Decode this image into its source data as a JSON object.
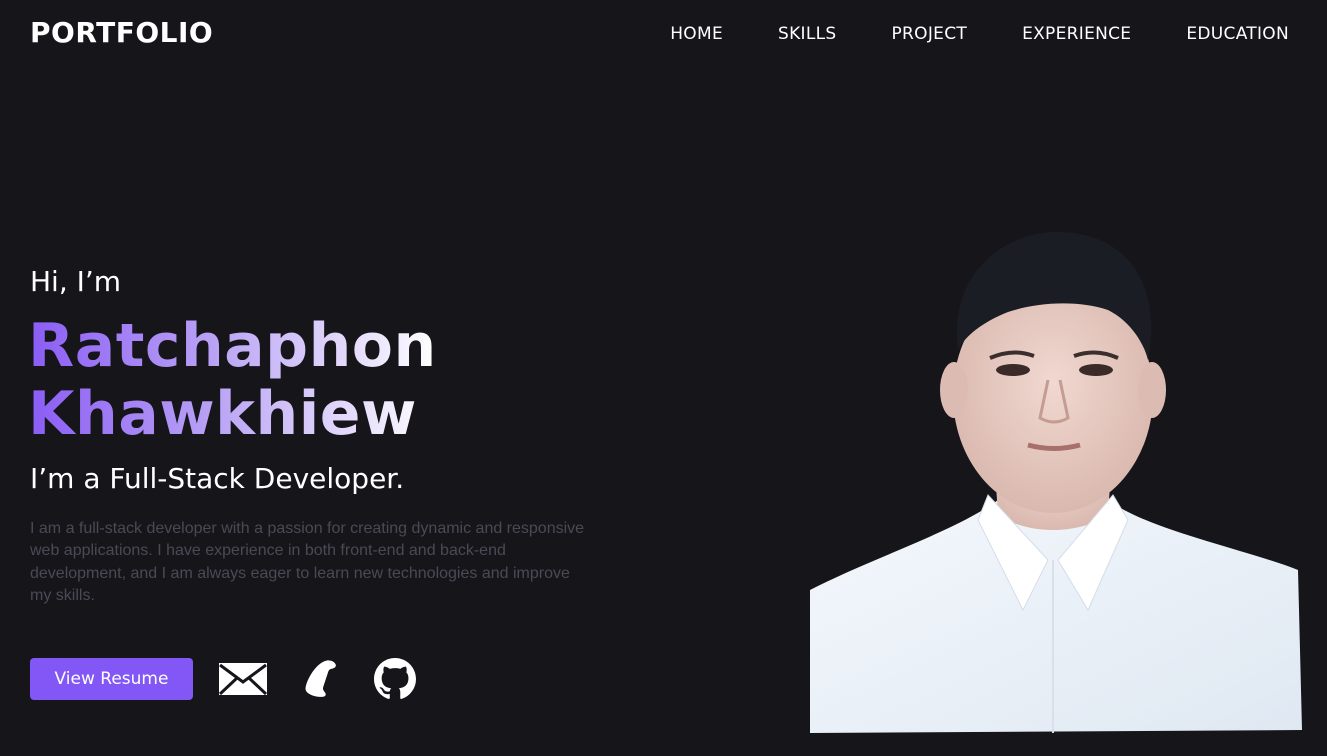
{
  "header": {
    "logo": "PORTFOLIO",
    "nav": [
      "HOME",
      "SKILLS",
      "PROJECT",
      "EXPERIENCE",
      "EDUCATION"
    ]
  },
  "hero": {
    "greeting": "Hi, I’m",
    "first_name": "Ratchaphon",
    "last_name": "Khawkhiew",
    "role": "I’m a Full-Stack Developer.",
    "description": "I am a full-stack developer with a passion for creating dynamic and responsive web applications. I have experience in both front-end and back-end development, and I am always eager to learn new technologies and improve my skills.",
    "resume_button": "View Resume",
    "contact_icons": [
      "mail-icon",
      "phone-icon",
      "github-icon"
    ]
  },
  "colors": {
    "background": "#16151a",
    "accent": "#8257f5",
    "muted_text": "#4a4a56"
  }
}
